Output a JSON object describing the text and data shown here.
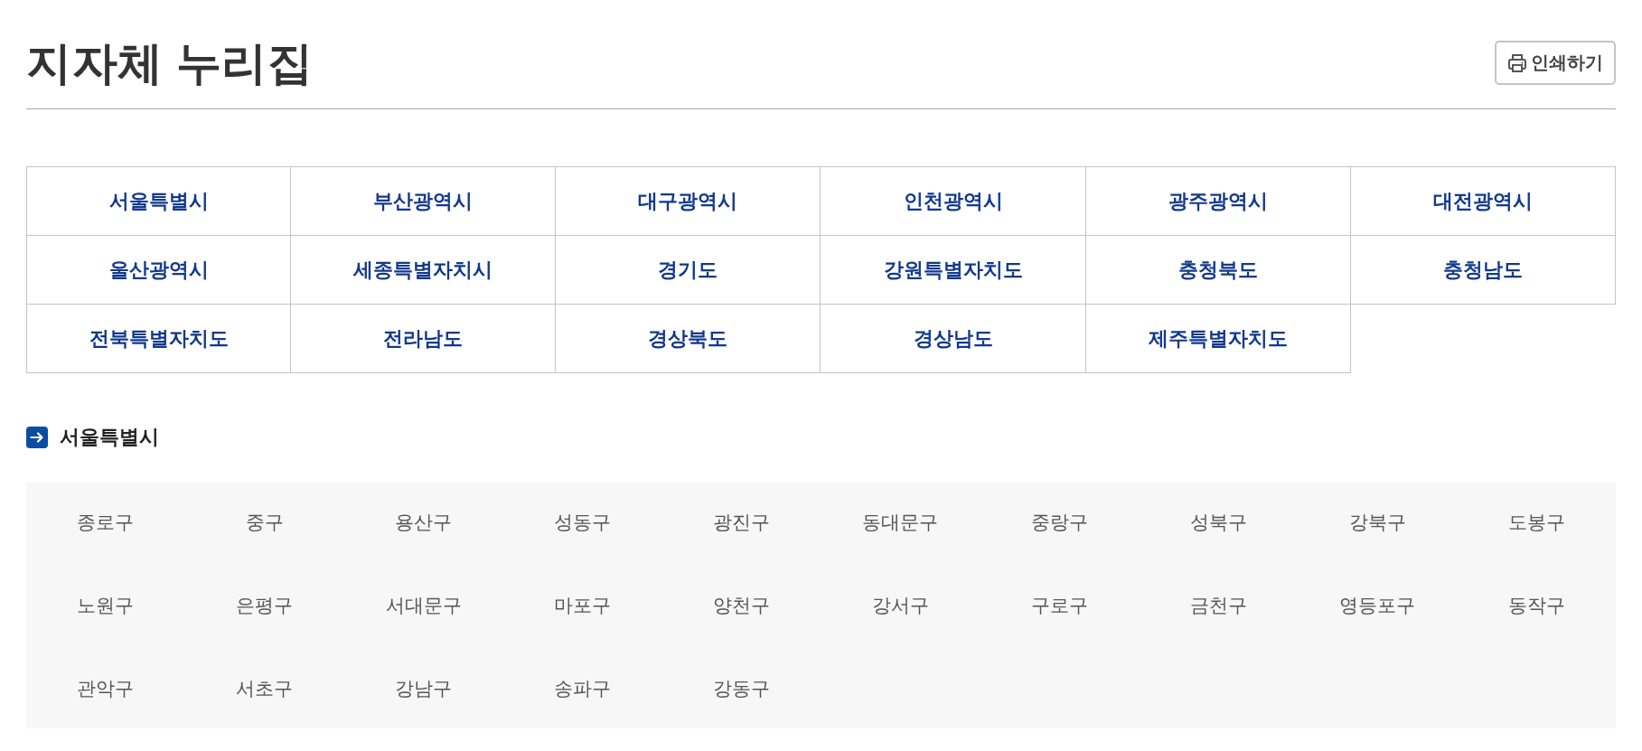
{
  "header": {
    "title": "지자체 누리집",
    "print_button": "인쇄하기"
  },
  "regions": [
    "서울특별시",
    "부산광역시",
    "대구광역시",
    "인천광역시",
    "광주광역시",
    "대전광역시",
    "울산광역시",
    "세종특별자치시",
    "경기도",
    "강원특별자치도",
    "충청북도",
    "충청남도",
    "전북특별자치도",
    "전라남도",
    "경상북도",
    "경상남도",
    "제주특별자치도"
  ],
  "section": {
    "title": "서울특별시",
    "districts": [
      "종로구",
      "중구",
      "용산구",
      "성동구",
      "광진구",
      "동대문구",
      "중랑구",
      "성북구",
      "강북구",
      "도봉구",
      "노원구",
      "은평구",
      "서대문구",
      "마포구",
      "양천구",
      "강서구",
      "구로구",
      "금천구",
      "영등포구",
      "동작구",
      "관악구",
      "서초구",
      "강남구",
      "송파구",
      "강동구"
    ]
  }
}
